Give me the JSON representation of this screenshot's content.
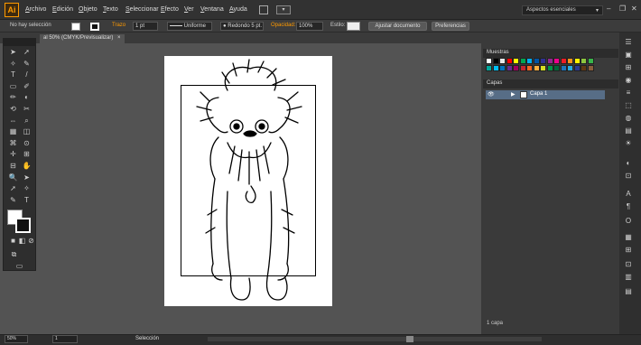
{
  "app": {
    "logo": "Ai"
  },
  "menu": {
    "items": [
      {
        "pre": "",
        "ul": "A",
        "post": "rchivo"
      },
      {
        "pre": "",
        "ul": "E",
        "post": "dición"
      },
      {
        "pre": "",
        "ul": "O",
        "post": "bjeto"
      },
      {
        "pre": "",
        "ul": "T",
        "post": "exto"
      },
      {
        "pre": "",
        "ul": "S",
        "post": "eleccionar"
      },
      {
        "pre": "",
        "ul": "E",
        "post": "fecto"
      },
      {
        "pre": "",
        "ul": "V",
        "post": "er"
      },
      {
        "pre": "",
        "ul": "V",
        "post": "entana"
      },
      {
        "pre": "",
        "ul": "A",
        "post": "yuda"
      }
    ],
    "workspace": "Aspectos esenciales",
    "workspace_arrow": "▾",
    "win_min": "–",
    "win_restore": "❐",
    "win_close": "✕"
  },
  "control": {
    "selection": "No hay selección",
    "stroke_label": "Trazo",
    "stroke_weight": "1 pt",
    "profile": "Uniforme",
    "brush": "Redondo 5 pt.",
    "opacity_label": "Opacidad:",
    "opacity": "100%",
    "style_label": "Estilo:",
    "doc_setup": "Ajustar documento",
    "prefs": "Preferencias"
  },
  "tab": {
    "title": "al 50% (CMYK/Previsualizar)",
    "close": "×"
  },
  "panels": {
    "swatches_title": "Muestras",
    "layers_title": "Capas",
    "layer_name": "Capa 1",
    "layer_count": "1 capa",
    "swatch_colors": [
      "#ffffff",
      "#000000",
      "#e8e8e8",
      "#ff0000",
      "#ffff00",
      "#00a651",
      "#00aeef",
      "#0054a6",
      "#2e3192",
      "#92278f",
      "#ec008c",
      "#ed1c24",
      "#f7941d",
      "#fff200",
      "#8dc63f",
      "#39b54a",
      "#00a99d",
      "#00bff3",
      "#0072bc",
      "#662d91",
      "#9e005d",
      "#c1272d",
      "#f26522",
      "#fbb040",
      "#d7df23",
      "#009444",
      "#006838",
      "#1b75bb",
      "#27aae1",
      "#2b3990",
      "#603913",
      "#8b5e3c"
    ]
  },
  "status": {
    "zoom": "50%",
    "page": "1",
    "selection_tool": "Selección"
  }
}
